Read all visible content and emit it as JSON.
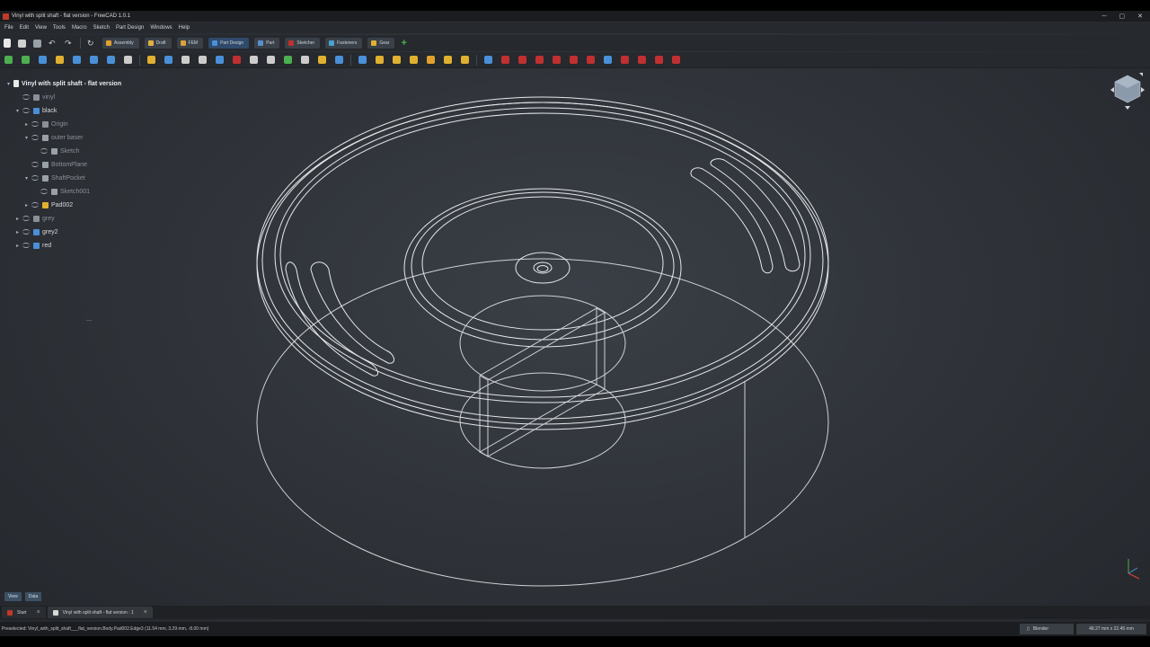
{
  "window": {
    "title": "Vinyl with split shaft - flat version - FreeCAD 1.0.1",
    "min": "─",
    "max": "▢",
    "close": "✕"
  },
  "menu": [
    "File",
    "Edit",
    "View",
    "Tools",
    "Macro",
    "Sketch",
    "Part Design",
    "Windows",
    "Help"
  ],
  "workbenches": [
    {
      "label": "Assembly",
      "color": "#e0a030",
      "active": false
    },
    {
      "label": "Draft",
      "color": "#e0b040",
      "active": false
    },
    {
      "label": "FEM",
      "color": "#d9a23a",
      "active": false
    },
    {
      "label": "Part Design",
      "color": "#4a90d9",
      "active": true
    },
    {
      "label": "Part",
      "color": "#5a8fd0",
      "active": false
    },
    {
      "label": "Sketcher",
      "color": "#c03030",
      "active": false
    },
    {
      "label": "Fasteners",
      "color": "#4aa0d0",
      "active": false
    },
    {
      "label": "Gear",
      "color": "#e0b030",
      "active": false
    }
  ],
  "tree": {
    "root": "Vinyl with split shaft - flat version",
    "items": [
      {
        "label": "vinyl",
        "level": 1,
        "dim": true,
        "arrow": "",
        "icon": "#8a8f98"
      },
      {
        "label": "black",
        "level": 1,
        "dim": false,
        "arrow": "▾",
        "icon": "#4a8fd9"
      },
      {
        "label": "Origin",
        "level": 2,
        "dim": true,
        "arrow": "▸",
        "icon": "#8a8f98"
      },
      {
        "label": "outer baser",
        "level": 2,
        "dim": true,
        "arrow": "▾",
        "icon": "#9aa0a8"
      },
      {
        "label": "Sketch",
        "level": 3,
        "dim": true,
        "arrow": "",
        "icon": "#9aa0a8"
      },
      {
        "label": "BottomPlane",
        "level": 2,
        "dim": true,
        "arrow": "",
        "icon": "#9aa0a8"
      },
      {
        "label": "ShaftPocket",
        "level": 2,
        "dim": true,
        "arrow": "▾",
        "icon": "#9aa0a8"
      },
      {
        "label": "Sketch001",
        "level": 3,
        "dim": true,
        "arrow": "",
        "icon": "#9aa0a8"
      },
      {
        "label": "Pad002",
        "level": 2,
        "dim": false,
        "arrow": "▸",
        "icon": "#e0b030"
      },
      {
        "label": "grey",
        "level": 1,
        "dim": true,
        "arrow": "▸",
        "icon": "#8a8f98"
      },
      {
        "label": "grey2",
        "level": 1,
        "dim": false,
        "arrow": "▸",
        "icon": "#4a8fd9"
      },
      {
        "label": "red",
        "level": 1,
        "dim": false,
        "arrow": "▸",
        "icon": "#4a8fd9"
      }
    ]
  },
  "panel_tabs": [
    "View",
    "Data"
  ],
  "doc_tabs": [
    {
      "label": "Start",
      "active": false
    },
    {
      "label": "Vinyl with split shaft - flat version : 1",
      "active": true
    }
  ],
  "status": {
    "preselected": "Preselected: Vinyl_with_split_shaft___flat_version.Body.Pad002.Edge3 (11.54 mm, 3.29 mm, -8.00 mm)",
    "nav_style": "Blender",
    "dimensions": "48.27 mm x 22.45 mm"
  },
  "colors": {
    "accent": "#4a90d9",
    "fc_red": "#c0392b",
    "wire": "#e6e8ea"
  }
}
